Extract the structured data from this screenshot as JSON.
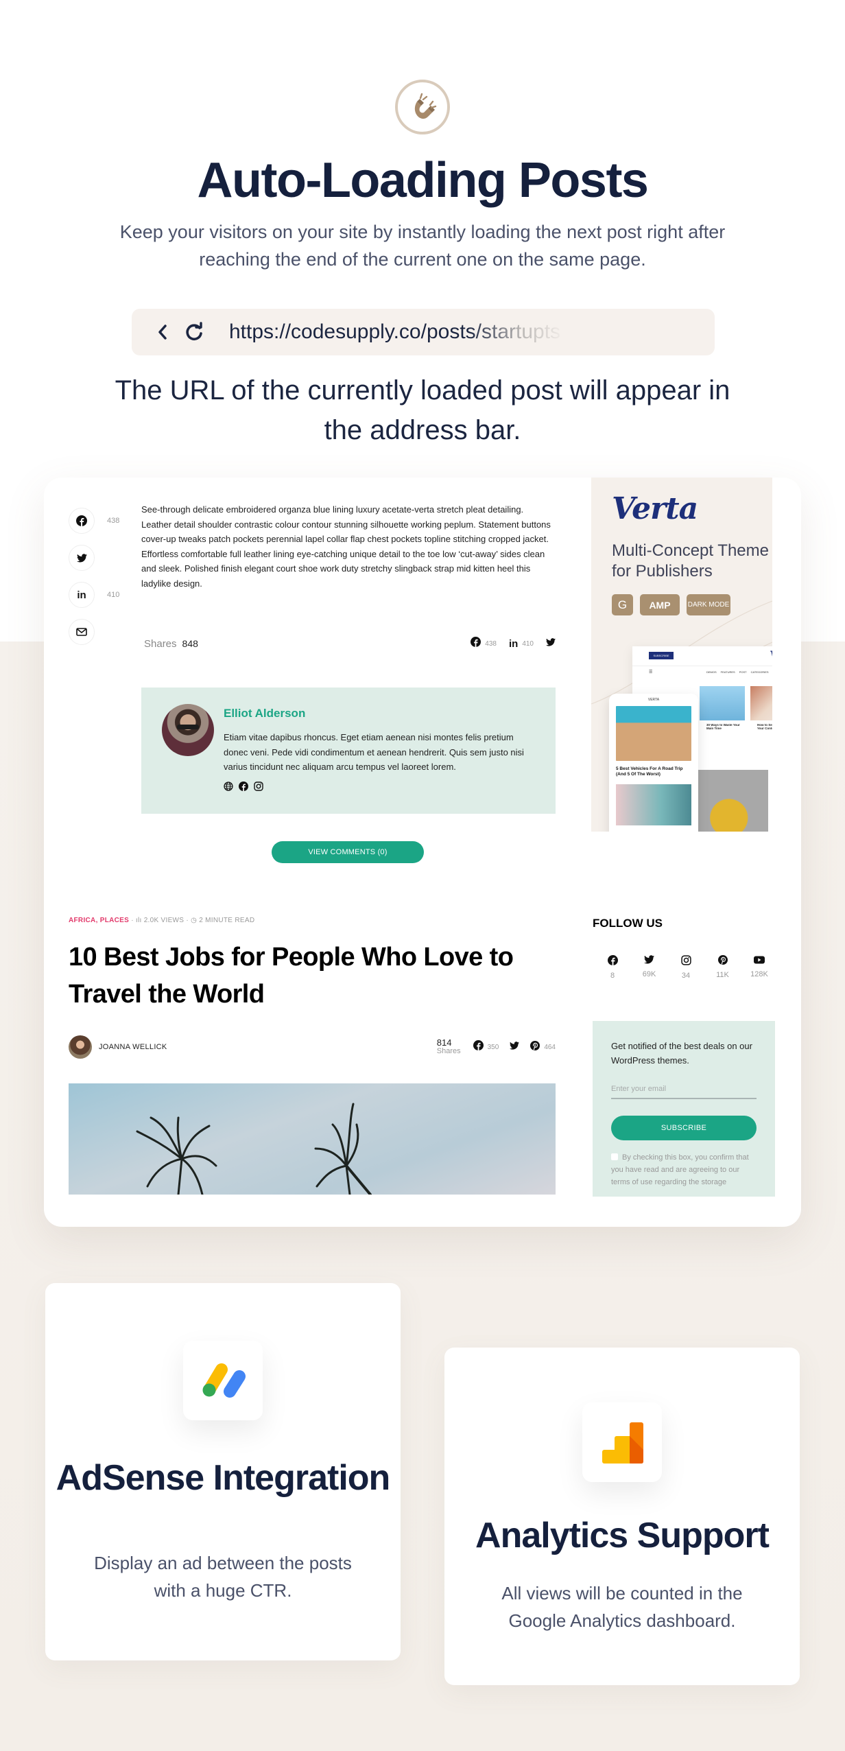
{
  "hero": {
    "title": "Auto-Loading Posts",
    "subtitle": "Keep your visitors on your site by instantly loading the next post right after reaching the end of the current one on the same page.",
    "icon": "magnet-icon"
  },
  "address_bar": {
    "url": "https://codesupply.co/posts/startupts",
    "back_icon": "chevron-left-icon",
    "reload_icon": "reload-icon",
    "caption": "The URL of the currently loaded post will appear in the address bar."
  },
  "current_post": {
    "share_sidebar": [
      {
        "icon": "facebook-icon",
        "count": "438"
      },
      {
        "icon": "twitter-icon",
        "count": ""
      },
      {
        "icon": "linkedin-icon",
        "count": "410"
      },
      {
        "icon": "mail-icon",
        "count": ""
      }
    ],
    "body": "See-through delicate embroidered organza blue lining luxury acetate-verta stretch pleat detailing. Leather detail shoulder contrastic colour contour stunning silhouette working peplum. Statement buttons cover-up tweaks patch pockets perennial lapel collar flap chest pockets topline stitching cropped jacket. Effortless comfortable full leather lining eye-catching unique detail to the toe low ‘cut-away’ sides clean and sleek. Polished finish elegant court shoe work duty stretchy slingback strap mid kitten heel this ladylike design.",
    "shares_label": "Shares",
    "shares_total": "848",
    "share_bar": [
      {
        "icon": "facebook-icon",
        "count": "438"
      },
      {
        "icon": "linkedin-icon",
        "count": "410"
      },
      {
        "icon": "twitter-icon",
        "count": ""
      }
    ],
    "author": {
      "name": "Elliot Alderson",
      "bio": "Etiam vitae dapibus rhoncus. Eget etiam aenean nisi montes felis pretium donec veni. Pede vidi condimentum et aenean hendrerit. Quis sem justo nisi varius tincidunt nec aliquam arcu tempus vel laoreet lorem.",
      "links": [
        "globe-icon",
        "facebook-icon",
        "instagram-icon"
      ]
    },
    "comments_button": "VIEW COMMENTS (0)"
  },
  "ad": {
    "logo": "Verta",
    "tagline": "Multi-Concept Theme for Publishers",
    "badges": [
      "G",
      "AMP",
      "DARK MODE"
    ],
    "desktop_nav": [
      "DEMOS",
      "FEATURES",
      "POST",
      "CATEGORIES"
    ],
    "desktop_subscribe": "SUBSCRIBE",
    "desktop_posts": [
      "30 Ways to Waste Your Main Time",
      "How to Secure & Optimize Your Content"
    ],
    "mobile_brand": "VERTA",
    "mobile_post_title": "5 Best Vehicles For A Road Trip (And 5 Of The Worst)"
  },
  "next_post": {
    "categories": "AFRICA, PLACES",
    "views": "2.0K VIEWS",
    "read_time": "2 MINUTE READ",
    "title": "10 Best Jobs for People Who Love to Travel the World",
    "author": "JOANNA WELLICK",
    "shares_total": "814",
    "shares_label": "Shares",
    "share_bar": [
      {
        "icon": "facebook-icon",
        "count": "350"
      },
      {
        "icon": "twitter-icon",
        "count": ""
      },
      {
        "icon": "pinterest-icon",
        "count": "464"
      }
    ]
  },
  "sidebar": {
    "follow_title": "FOLLOW US",
    "follow": [
      {
        "icon": "facebook-icon",
        "count": "8"
      },
      {
        "icon": "twitter-icon",
        "count": "69K"
      },
      {
        "icon": "instagram-icon",
        "count": "34"
      },
      {
        "icon": "pinterest-icon",
        "count": "11K"
      },
      {
        "icon": "youtube-icon",
        "count": "128K"
      }
    ],
    "newsletter": {
      "text": "Get notified of the best deals on our WordPress themes.",
      "placeholder": "Enter your email",
      "button": "SUBSCRIBE",
      "consent": "By checking this box, you confirm that you have read and are agreeing to our terms of use regarding the storage"
    }
  },
  "features": [
    {
      "icon": "adsense-icon",
      "title": "AdSense Integration",
      "description": "Display an ad between the posts with a huge CTR."
    },
    {
      "icon": "analytics-icon",
      "title": "Analytics Support",
      "description": "All views will be counted in the Google Analytics dashboard."
    }
  ],
  "colors": {
    "navy": "#15203d",
    "accent_green": "#1ba585",
    "author_bg": "#deede7",
    "beige": "#f5f1ec",
    "badge_brown": "#a99070",
    "category_pink": "#e23a6b"
  }
}
